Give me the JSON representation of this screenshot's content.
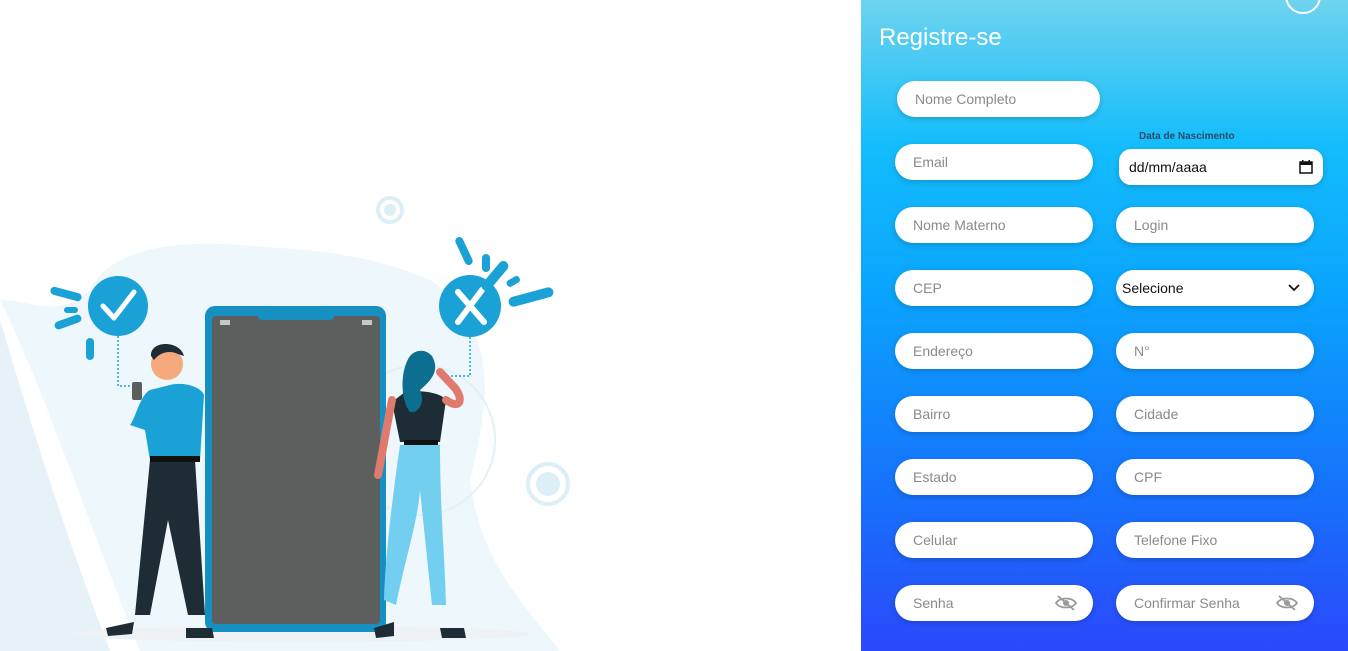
{
  "panel": {
    "title": "Registre-se",
    "fields": {
      "nome_completo": "Nome Completo",
      "data_nascimento_label": "Data de Nascimento",
      "data_nascimento_placeholder": "dd/mm/aaaa",
      "email": "Email",
      "nome_materno": "Nome Materno",
      "login": "Login",
      "cep": "CEP",
      "estado_select": "Selecione",
      "endereco": "Endereço",
      "numero": "N°",
      "bairro": "Bairro",
      "cidade": "Cidade",
      "estado": "Estado",
      "cpf": "CPF",
      "celular": "Celular",
      "telefone_fixo": "Telefone Fixo",
      "senha": "Senha",
      "confirmar_senha": "Confirmar Senha"
    }
  },
  "colors": {
    "accent": "#14bdfb",
    "gradient_bottom": "#2b48fb",
    "illustration_blue": "#1aa2d6"
  }
}
